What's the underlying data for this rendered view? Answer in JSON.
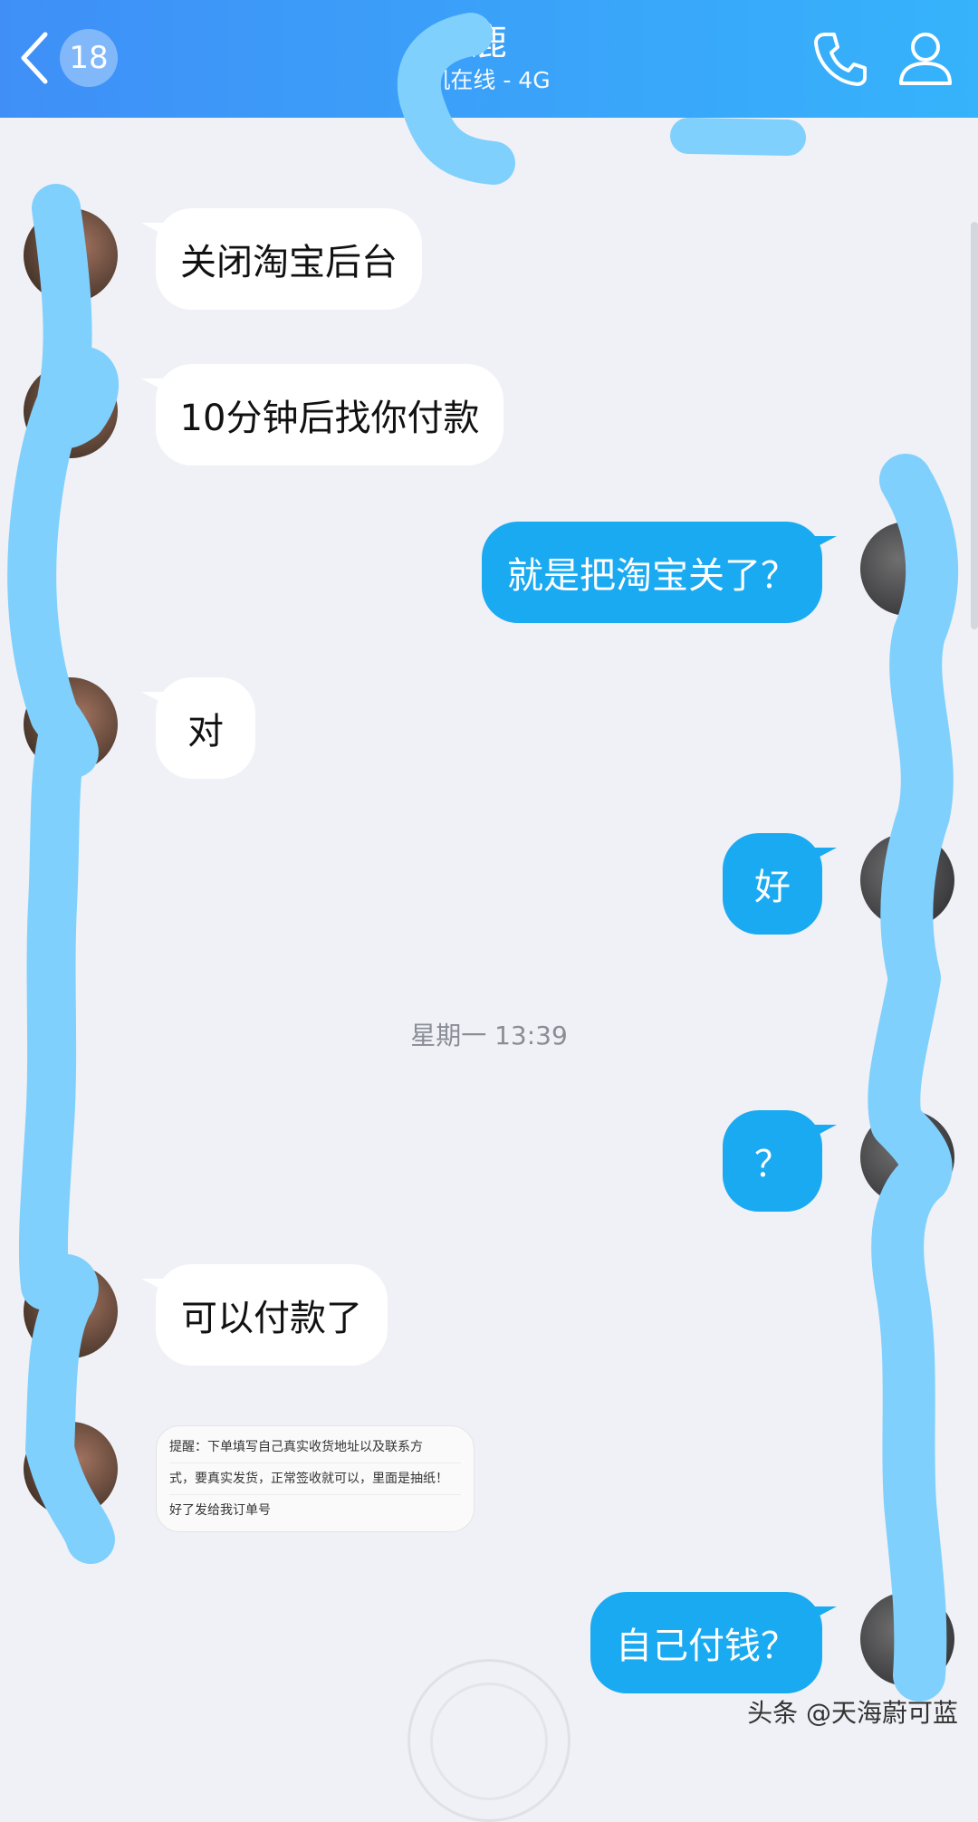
{
  "header": {
    "back_count": "18",
    "title": "鹿",
    "status": "机在线 - 4G",
    "bg_colors": [
      "#3f8ff7",
      "#36b3fb"
    ]
  },
  "messages": [
    {
      "side": "left",
      "text": "关闭淘宝后台"
    },
    {
      "side": "left",
      "text": "10分钟后找你付款"
    },
    {
      "side": "right",
      "text": "就是把淘宝关了？"
    },
    {
      "side": "left",
      "text": "对"
    },
    {
      "side": "right",
      "text": "好"
    },
    {
      "side": "right",
      "text": "？"
    },
    {
      "side": "left",
      "text": "可以付款了"
    },
    {
      "side": "right",
      "text": "自己付钱？"
    }
  ],
  "timestamp": "星期一 13:39",
  "note_image": {
    "lines": [
      "提醒：下单填写自己真实收货地址以及联系方",
      "式，要真实发货，正常签收就可以，里面是抽纸！",
      "好了发给我订单号"
    ]
  },
  "watermark": "头条 @天海蔚可蓝",
  "colors": {
    "bubble_right": "#1aaaf2",
    "bubble_left": "#ffffff",
    "background": "#f0f1f6",
    "redaction_stroke": "#7fd0fd"
  },
  "icons": {
    "back": "chevron-left-icon",
    "call": "phone-icon",
    "profile": "person-icon"
  }
}
